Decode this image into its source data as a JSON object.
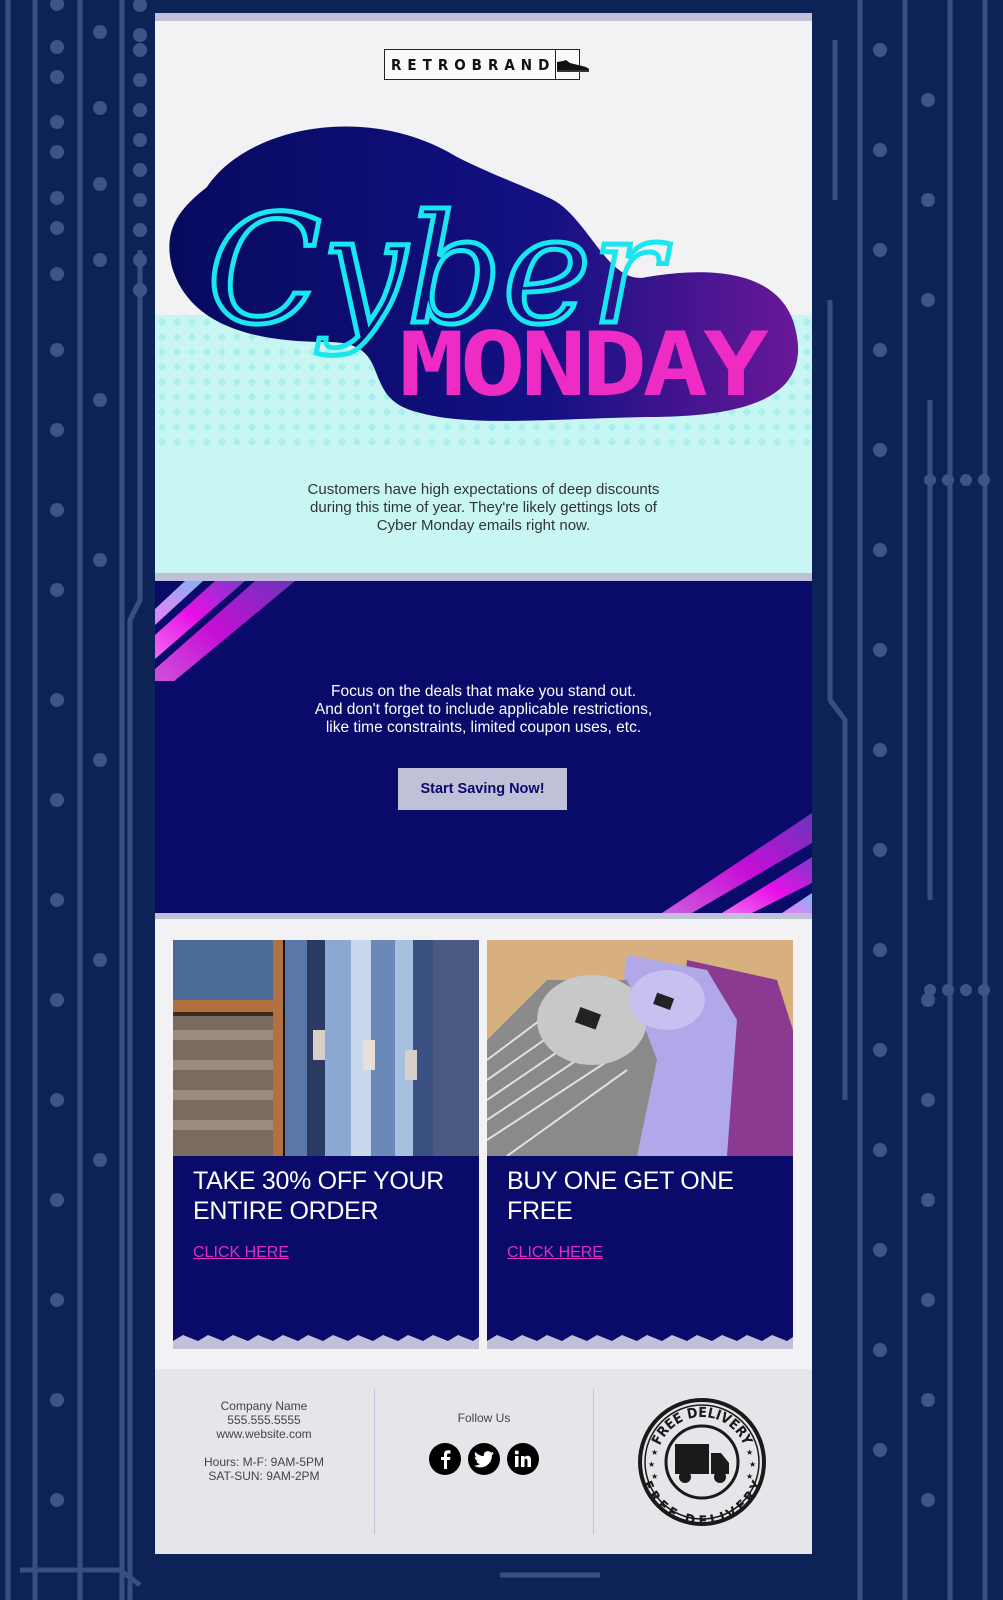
{
  "brand": {
    "logo_text": "RETROBRAND",
    "logo_icon": "shoe-icon"
  },
  "hero": {
    "title_script": "Cyber",
    "title_block": "MONDAY",
    "intro_lines": [
      "Customers have high expectations of deep discounts",
      "during this time of year. They're likely gettings lots of",
      "Cyber Monday emails right now."
    ]
  },
  "deals": {
    "lines": [
      "Focus on the deals that make you stand out.",
      "And don't forget to include applicable restrictions,",
      "like time constraints, limited coupon uses, etc."
    ],
    "cta_label": "Start Saving Now!"
  },
  "offers": [
    {
      "image": "jeans-store-photo",
      "title_lines": [
        "TAKE 30% OFF YOUR",
        "ENTIRE ORDER"
      ],
      "link_label": "CLICK HERE"
    },
    {
      "image": "folded-shirts-photo",
      "title_lines": [
        "BUY ONE GET ONE",
        "FREE"
      ],
      "link_label": "CLICK HERE"
    }
  ],
  "footer": {
    "company_name": "Company Name",
    "phone": "555.555.5555",
    "website": "www.website.com",
    "hours_weekday": "Hours: M-F: 9AM-5PM",
    "hours_weekend": "SAT-SUN: 9AM-2PM",
    "follow_label": "Follow Us",
    "socials": [
      {
        "name": "facebook",
        "icon": "facebook-icon",
        "glyph": "f"
      },
      {
        "name": "twitter",
        "icon": "twitter-icon",
        "glyph": "t"
      },
      {
        "name": "linkedin",
        "icon": "linkedin-icon",
        "glyph": "in"
      }
    ],
    "badge_text_top": "FREE DELIVERY",
    "badge_text_bottom": "FREE DELIVERY"
  },
  "colors": {
    "page_bg": "#0d2358",
    "navy": "#0a0a6b",
    "lavender": "#c0c0d8",
    "mint": "#c8f6f3",
    "cyan": "#19e6ee",
    "magenta": "#ee2bc4",
    "link_pink": "#e02bc9"
  }
}
